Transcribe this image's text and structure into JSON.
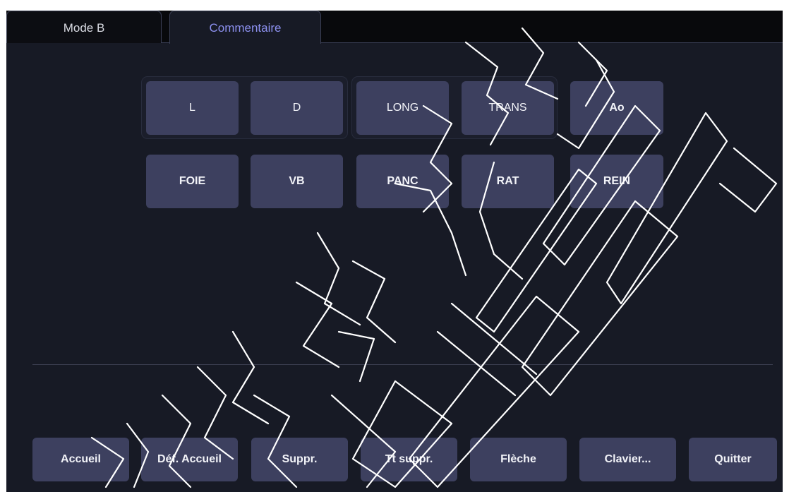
{
  "tabs": [
    {
      "label": "Mode B",
      "active": false
    },
    {
      "label": "Commentaire",
      "active": true
    }
  ],
  "comment_row1": [
    "L",
    "D",
    "LONG",
    "TRANS",
    "Ao"
  ],
  "comment_row2": [
    "FOIE",
    "VB",
    "PANC",
    "RAT",
    "REIN"
  ],
  "actions": {
    "accueil": "Accueil",
    "def_accueil": "Déf. Accueil",
    "suppr": "Suppr.",
    "tt_suppr": "Tt suppr.",
    "fleche": "Flèche",
    "clavier": "Clavier...",
    "quitter": "Quitter"
  },
  "colors": {
    "background": "#171a25",
    "button": "#3d405f",
    "active_tab_text": "#8c90ee",
    "watermark": "#ffffff"
  }
}
